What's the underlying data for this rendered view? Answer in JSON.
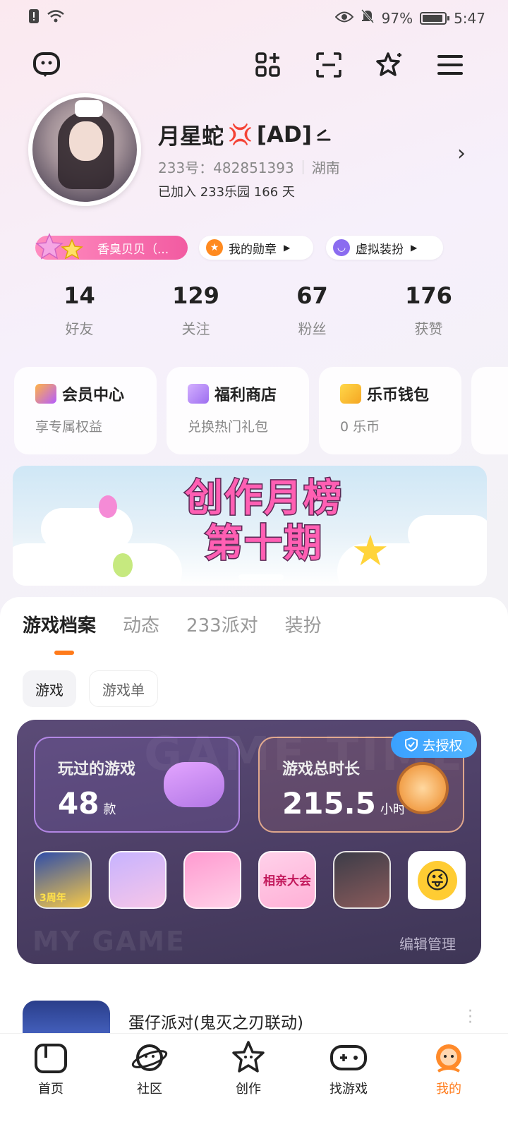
{
  "status": {
    "battery": "97%",
    "time": "5:47"
  },
  "profile": {
    "name": "月星蛇",
    "name_tag": "[AD]",
    "uid": "233号：482851393",
    "region": "湖南",
    "joined": "已加入 233乐园 166 天"
  },
  "badges": [
    {
      "label": "香臭贝贝（..."
    },
    {
      "label": "我的勋章"
    },
    {
      "label": "虚拟装扮"
    }
  ],
  "stats": [
    {
      "num": "14",
      "label": "好友"
    },
    {
      "num": "129",
      "label": "关注"
    },
    {
      "num": "67",
      "label": "粉丝"
    },
    {
      "num": "176",
      "label": "获赞"
    }
  ],
  "cards": [
    {
      "title": "会员中心",
      "sub": "享专属权益"
    },
    {
      "title": "福利商店",
      "sub": "兑换热门礼包"
    },
    {
      "title": "乐币钱包",
      "sub": "0 乐币"
    }
  ],
  "banner": {
    "line1": "创作月榜",
    "line2": "第十期"
  },
  "tabs": [
    "游戏档案",
    "动态",
    "233派对",
    "装扮"
  ],
  "chips": [
    "游戏",
    "游戏单"
  ],
  "game_card": {
    "played_title": "玩过的游戏",
    "played_value": "48",
    "played_unit": "款",
    "time_title": "游戏总时长",
    "time_value": "215.5",
    "time_unit": "小时",
    "auth": "去授权",
    "game_tag": "3周年",
    "game4_text": "相亲大会",
    "edit": "编辑管理",
    "watermark": "MY GAME",
    "watermark_top": "GAME TIME"
  },
  "list_item": {
    "title": "蛋仔派对(鬼灭之刃联动)"
  },
  "nav": [
    "首页",
    "社区",
    "创作",
    "找游戏",
    "我的"
  ]
}
